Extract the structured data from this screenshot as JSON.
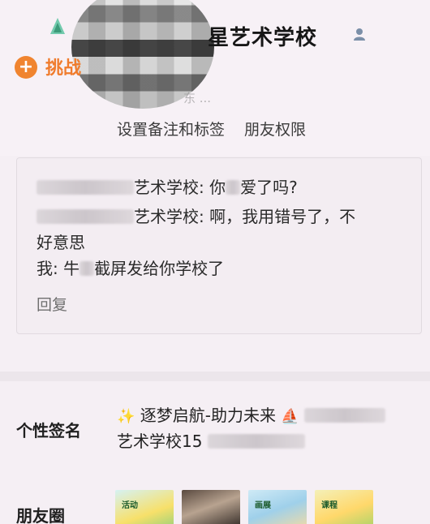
{
  "header": {
    "title": "星艺术学校",
    "challenge_label": "挑战",
    "faint_subtitle": "东 ..."
  },
  "actions": {
    "notes_label": "设置备注和标签",
    "permissions_label": "朋友权限"
  },
  "message_card": {
    "line1": {
      "prefix_redacted": true,
      "text": "艺术学校: 你",
      "suffix": "爱了吗?"
    },
    "line2": {
      "prefix_redacted": true,
      "text": "艺术学校: 啊，我用错号了，不"
    },
    "line3": {
      "text": "好意思"
    },
    "line4": {
      "text_before": "我: 牛",
      "text_after": "截屏发给你学校了"
    },
    "reply_label": "回复"
  },
  "signature": {
    "label": "个性签名",
    "line1": "逐梦启航-助力未来",
    "line2": "艺术学校15"
  },
  "moments": {
    "label": "朋友圈",
    "thumbs": [
      {
        "name": "moment-thumb-1",
        "caption": "活动"
      },
      {
        "name": "moment-thumb-2",
        "caption": ""
      },
      {
        "name": "moment-thumb-3",
        "caption": "画展"
      },
      {
        "name": "moment-thumb-4",
        "caption": "课程"
      }
    ]
  },
  "colors": {
    "accent_orange": "#f07c2d",
    "background": "#f5eff4",
    "card_border": "#e1dae0"
  }
}
